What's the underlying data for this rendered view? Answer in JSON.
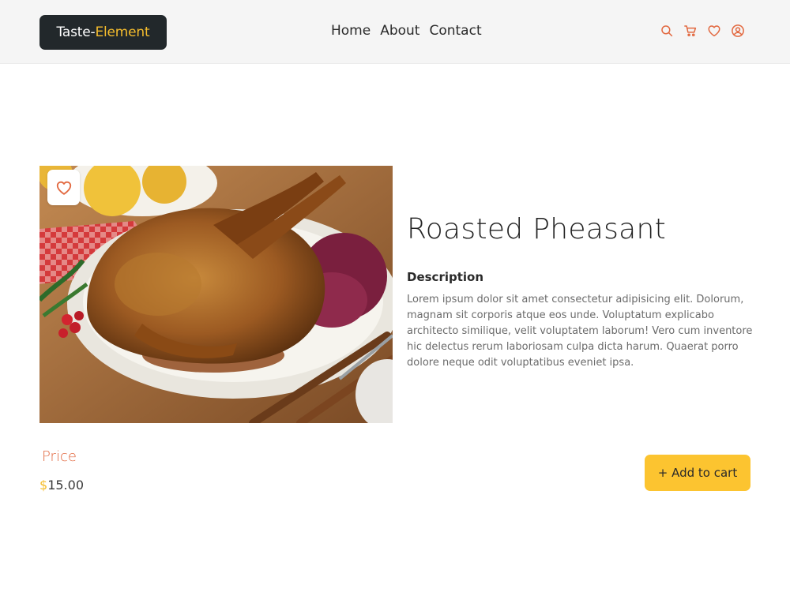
{
  "brand": {
    "name_part1": "Taste-",
    "name_part2": "Element"
  },
  "nav": {
    "items": [
      "Home",
      "About",
      "Contact"
    ]
  },
  "header_icons": [
    "search-icon",
    "cart-icon",
    "heart-icon",
    "user-icon"
  ],
  "product": {
    "title": "Roasted Pheasant",
    "description_heading": "Description",
    "description": "Lorem ipsum dolor sit amet consectetur adipisicing elit. Dolorum, magnam sit corporis atque eos unde. Voluptatum explicabo architecto similique, velit voluptatem laborum! Vero cum inventore hic delectus rerum laboriosam culpa dicta harum. Quaerat porro dolore neque odit voluptatibus eveniet ipsa.",
    "price_label": "Price",
    "price_currency": "$",
    "price_amount": "15.00",
    "add_to_cart_label": "+ Add to cart"
  },
  "colors": {
    "accent_orange": "#e2683f",
    "accent_yellow": "#fcc430",
    "logo_bg": "#22282b",
    "header_bg": "#f5f5f5"
  }
}
